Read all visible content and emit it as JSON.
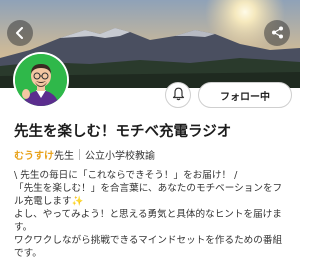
{
  "header": {
    "back_icon": "chevron-left-icon",
    "share_icon": "share-icon"
  },
  "profile": {
    "avatar_icon": "teacher-avatar",
    "bell_icon": "bell-icon",
    "follow_label": "フォロー中"
  },
  "channel": {
    "title": "先生を楽しむ！モチベ充電ラジオ",
    "author_name": "むうすけ",
    "author_suffix": "先生",
    "author_role": "公立小学校教諭"
  },
  "description": {
    "lines": [
      "\\ 先生の毎日に「これならできそう！」をお届け！ /",
      "「先生を楽しむ！」を合言葉に、あなたのモチベーションをフ",
      "ル充電します✨",
      "よし、やってみよう！と思える勇気と具体的なヒントを届けま",
      "す。",
      " ワクワクしながら挑戦できるマインドセットを作るための番組",
      "です。"
    ]
  },
  "colors": {
    "accent": "#e8a21a",
    "avatar_bg": "#2fb84a"
  }
}
